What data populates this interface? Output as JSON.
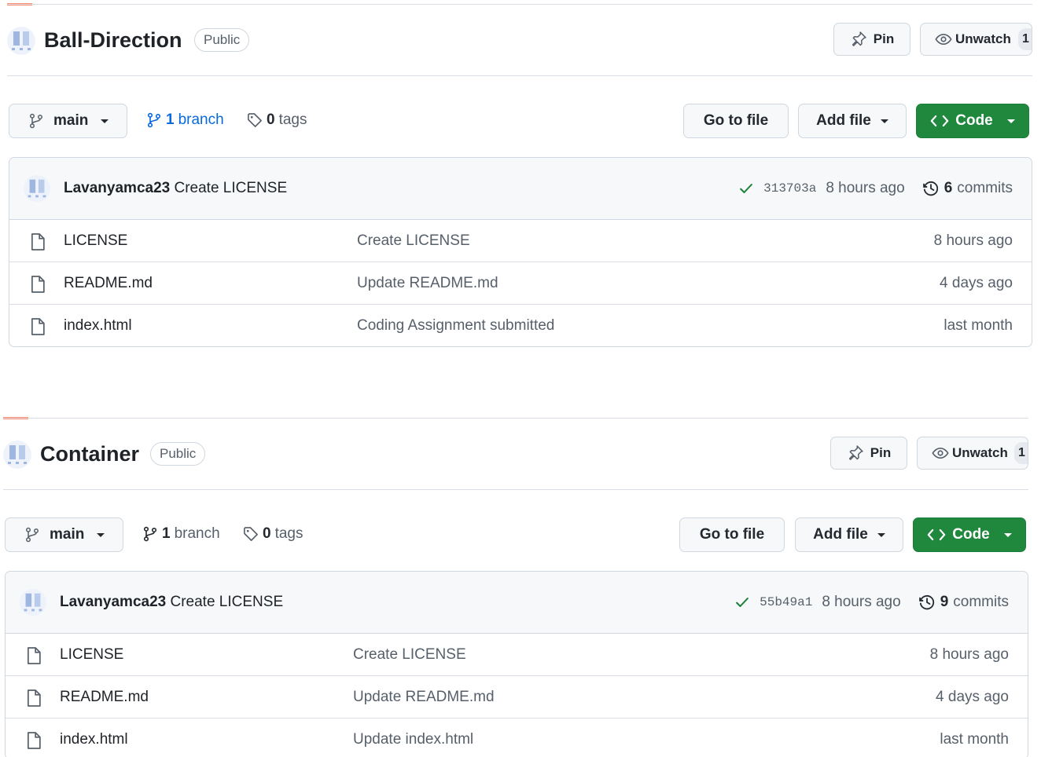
{
  "repos": [
    {
      "name": "Ball-Direction",
      "visibility": "Public",
      "pin_label": "Pin",
      "unwatch_label": "Unwatch",
      "watch_count": "1",
      "branch_selector": "main",
      "branches_count": "1",
      "branches_label": "branch",
      "tags_count": "0",
      "tags_label": "tags",
      "go_to_file": "Go to file",
      "add_file": "Add file",
      "code": "Code",
      "commit": {
        "author": "Lavanyamca23",
        "message": "Create LICENSE",
        "sha": "313703a",
        "time": "8 hours ago",
        "commits_count": "6",
        "commits_label": "commits"
      },
      "files": [
        {
          "name": "LICENSE",
          "message": "Create LICENSE",
          "age": "8 hours ago"
        },
        {
          "name": "README.md",
          "message": "Update README.md",
          "age": "4 days ago"
        },
        {
          "name": "index.html",
          "message": "Coding Assignment submitted",
          "age": "last month"
        }
      ]
    },
    {
      "name": "Container",
      "visibility": "Public",
      "pin_label": "Pin",
      "unwatch_label": "Unwatch",
      "watch_count": "1",
      "branch_selector": "main",
      "branches_count": "1",
      "branches_label": "branch",
      "tags_count": "0",
      "tags_label": "tags",
      "go_to_file": "Go to file",
      "add_file": "Add file",
      "code": "Code",
      "commit": {
        "author": "Lavanyamca23",
        "message": "Create LICENSE",
        "sha": "55b49a1",
        "time": "8 hours ago",
        "commits_count": "9",
        "commits_label": "commits"
      },
      "files": [
        {
          "name": "LICENSE",
          "message": "Create LICENSE",
          "age": "8 hours ago"
        },
        {
          "name": "README.md",
          "message": "Update README.md",
          "age": "4 days ago"
        },
        {
          "name": "index.html",
          "message": "Update index.html",
          "age": "last month"
        }
      ]
    }
  ],
  "colors": {
    "accent_green": "#1f883d",
    "link_blue": "#0969da",
    "check_green": "#1a7f37",
    "tab_underline": "#fd8c73"
  },
  "icons": {
    "pin": "pin-icon",
    "eye": "eye-icon",
    "branch": "git-branch-icon",
    "tag": "tag-icon",
    "code": "code-icon",
    "check": "check-icon",
    "history": "history-icon",
    "file": "file-icon"
  }
}
